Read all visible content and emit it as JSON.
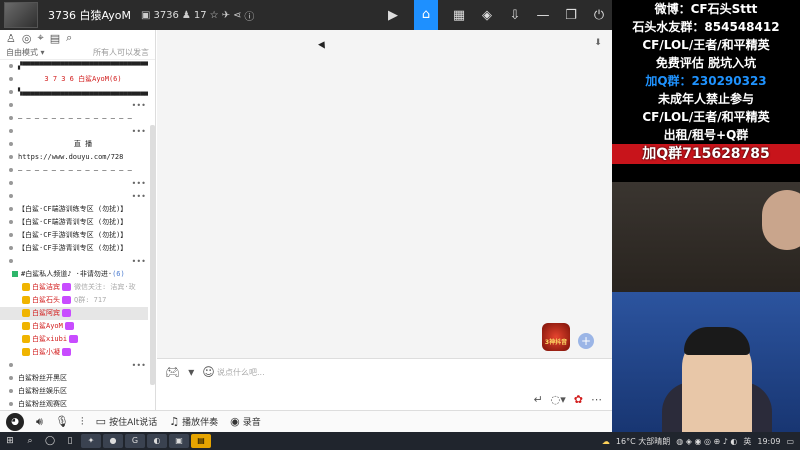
{
  "app": {
    "title": "3736 白猿AyoM",
    "room_id": "3736",
    "online_count": "17"
  },
  "left_panel": {
    "mode_label": "自由模式",
    "permission_note": "所有人可以发言",
    "channels": [
      {
        "text": "▞▀▀▀▀▀▀▀▀▀▀▀▀▀▀▀▀▀▀▀▀▀▀▀▀▀▀▀▀▀▀▀▚",
        "style": "plain"
      },
      {
        "text": "3 7 3 6 白鲨AyoM(6)",
        "style": "red-center"
      },
      {
        "text": "▚▄▄▄▄▄▄▄▄▄▄▄▄▄▄▄▄▄▄▄▄▄▄▄▄▄▄▄▄▄▄▄▞",
        "style": "plain"
      },
      {
        "text": "",
        "style": "plain"
      },
      {
        "text": "— — — — — — — — — — — — — —",
        "style": "plain"
      },
      {
        "text": "",
        "style": "plain"
      },
      {
        "text": "直 播",
        "style": "center"
      },
      {
        "text": "https://www.douyu.com/728",
        "style": "plain"
      },
      {
        "text": "— — — — — — — — — — — — — —",
        "style": "plain"
      },
      {
        "text": "",
        "style": "plain"
      },
      {
        "text": "",
        "style": "plain"
      },
      {
        "text": "【白鲨·CF端游训练专区 (勿扰)】",
        "style": "plain"
      },
      {
        "text": "【白鲨·CF端游青训专区 (勿扰)】",
        "style": "plain"
      },
      {
        "text": "【白鲨·CF手游训练专区 (勿扰)】",
        "style": "plain"
      },
      {
        "text": "【白鲨·CF手游青训专区 (勿扰)】",
        "style": "plain"
      },
      {
        "text": "",
        "style": "plain"
      }
    ],
    "group_title": "#白鲨私人频道♪",
    "group_note": "·非请勿进·",
    "group_count": "(6)",
    "users": [
      {
        "name": "白鲨洁宾",
        "note": "微信关注: 洁宾·玫"
      },
      {
        "name": "白鲨石头",
        "note": "Q群: 717"
      },
      {
        "name": "白鲨阿宾",
        "note": ""
      },
      {
        "name": "白鲨AyoM",
        "note": ""
      },
      {
        "name": "白鲨xiubi",
        "note": ""
      },
      {
        "name": "白鲨小凝",
        "note": ""
      }
    ],
    "fans": [
      {
        "text": "",
        "style": "plain"
      },
      {
        "text": "白鲨粉丝开黑区",
        "style": "plain"
      },
      {
        "text": "白鲨粉丝娱乐区",
        "style": "plain"
      },
      {
        "text": "白鲨粉丝观赛区",
        "style": "plain"
      },
      {
        "text": "白鲨粉丝休憩室",
        "style": "blue",
        "count": "(4)"
      },
      {
        "text": "白鲨铁粉小窝",
        "style": "plain"
      }
    ]
  },
  "chat": {
    "placeholder": "说点什么吧...",
    "game_badge_text": "3神抖音"
  },
  "bottombar": {
    "ptt_label": "按住Alt说话",
    "music_label": "播放伴奏",
    "record_label": "录音"
  },
  "taskbar": {
    "weather": "16°C 大部晴朗",
    "time": "19:09"
  },
  "overlay": {
    "lines": [
      {
        "text": "微博：CF石头Sttt",
        "style": "plain"
      },
      {
        "text": "石头水友群：854548412",
        "style": "plain"
      },
      {
        "text": "CF/LOL/王者/和平精英",
        "style": "plain"
      },
      {
        "text": "免费评估 脱坑入坑",
        "style": "plain"
      },
      {
        "text": "加Q群：230290323",
        "style": "blue"
      },
      {
        "text": "未成年人禁止参与",
        "style": "plain"
      },
      {
        "text": "CF/LOL/王者/和平精英",
        "style": "plain"
      },
      {
        "text": "出租/租号+Q群",
        "style": "plain"
      },
      {
        "text": "加Q群715628785",
        "style": "redbg"
      }
    ]
  },
  "colors": {
    "accent": "#1e90ff",
    "name_red": "#d21c1c",
    "titlebar": "#2b2b2b"
  }
}
